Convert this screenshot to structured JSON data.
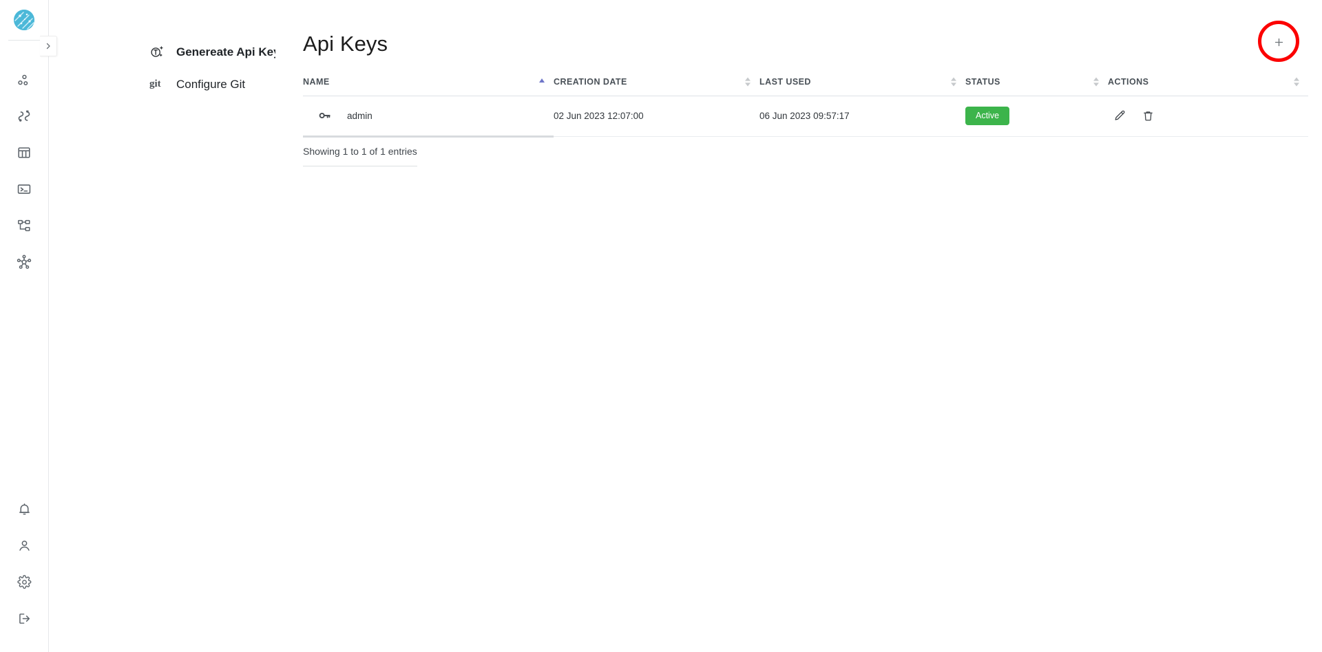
{
  "app": {
    "logo_name": "circuit-globe-logo",
    "brand_color": "#4bb8d8"
  },
  "icon_rail": {
    "collapse_label": "›",
    "top_items": [
      {
        "name": "pipelines-icon",
        "glyph": "pipelines"
      },
      {
        "name": "connections-icon",
        "glyph": "connections"
      },
      {
        "name": "tables-icon",
        "glyph": "tables"
      },
      {
        "name": "terminal-icon",
        "glyph": "terminal"
      },
      {
        "name": "sitemap-icon",
        "glyph": "sitemap"
      },
      {
        "name": "network-icon",
        "glyph": "network"
      }
    ],
    "bottom_items": [
      {
        "name": "notifications-icon",
        "glyph": "bell"
      },
      {
        "name": "profile-icon",
        "glyph": "user"
      },
      {
        "name": "settings-icon",
        "glyph": "gear"
      },
      {
        "name": "logout-icon",
        "glyph": "logout"
      }
    ]
  },
  "sidebar": {
    "items": [
      {
        "label": "Genereate Api Key",
        "icon": "generate-key-icon",
        "active": true
      },
      {
        "label": "Configure Git",
        "icon": "git-icon",
        "icon_text": "git",
        "active": false
      }
    ]
  },
  "header": {
    "title": "Api Keys",
    "add_button_label": "+",
    "add_button_highlight_color": "#fc0000"
  },
  "table": {
    "columns": [
      {
        "label": "Name",
        "sort": "asc"
      },
      {
        "label": "Creation Date",
        "sort": "none"
      },
      {
        "label": "Last Used",
        "sort": "none"
      },
      {
        "label": "Status",
        "sort": "none"
      },
      {
        "label": "Actions",
        "sort": "none"
      }
    ],
    "rows": [
      {
        "name": "admin",
        "creation_date": "02 Jun 2023 12:07:00",
        "last_used": "06 Jun 2023 09:57:17",
        "status": "Active",
        "status_color": "#3cb44b",
        "actions": [
          "edit-icon",
          "delete-icon"
        ]
      }
    ],
    "footer_text": "Showing 1 to 1 of 1 entries"
  }
}
